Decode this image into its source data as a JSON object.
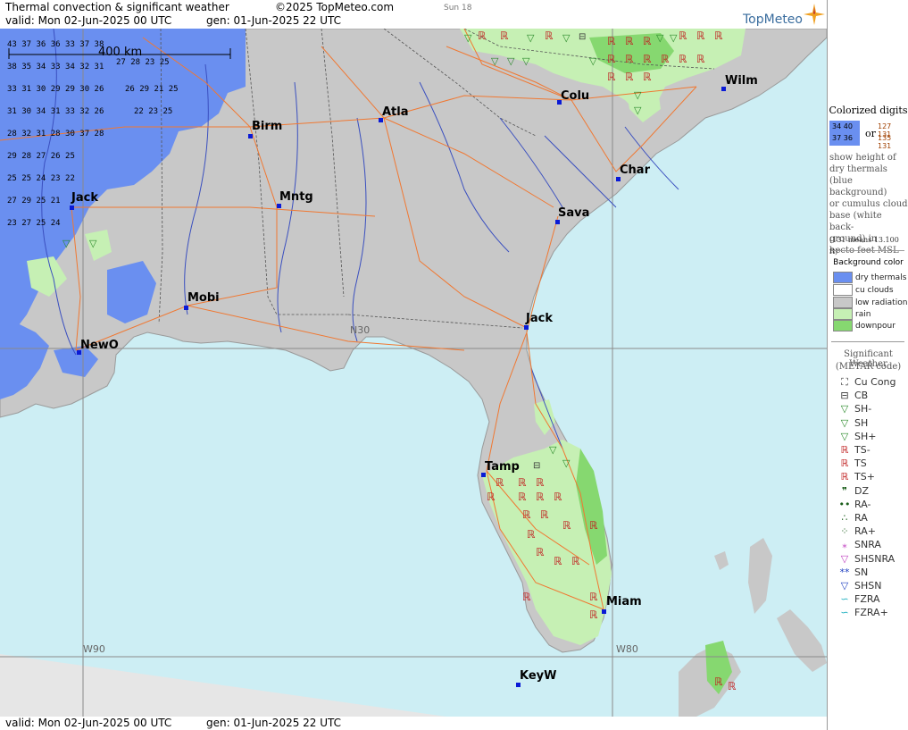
{
  "header": {
    "title": "Thermal convection & significant weather",
    "copyright": "©2025 TopMeteo.com",
    "time_label": "Sun 18",
    "valid": "valid:  Mon  02-Jun-2025  00 UTC",
    "generated": "gen: 01-Jun-2025 22 UTC",
    "logo": "TopMeteo"
  },
  "footer": {
    "valid": "valid:  Mon  02-Jun-2025  00 UTC",
    "generated": "gen: 01-Jun-2025 22 UTC"
  },
  "map": {
    "scale_label": "400 km",
    "grid_labels": [
      "N30",
      "W90",
      "W80"
    ],
    "cities": [
      "Wilm",
      "Colu",
      "Atla",
      "Birm",
      "Char",
      "Mntg",
      "Jack",
      "Sava",
      "Mobi",
      "Jack",
      "NewO",
      "Tamp",
      "Miam",
      "KeyW"
    ],
    "colors": {
      "sea": "#cdeef4",
      "land": "#c8c8c8",
      "dry_thermals": "#6a8ff0",
      "rain": "#c6f0b4",
      "downpour": "#86d870",
      "roads": "#f07832",
      "rivers": "#3a4fbf",
      "city": "#0a1ad6"
    }
  },
  "legend": {
    "digits_title": "Colorized digits",
    "digits_or": "or",
    "digits_desc": [
      "show height of",
      "dry thermals",
      "(blue background)",
      "or cumulus cloud",
      "base (white back-",
      "ground) in",
      "hecto feet MSL"
    ],
    "digits_note": "(131 means 13.100 ft)",
    "bg_title": "Background color",
    "bg_items": [
      {
        "label": "dry thermals",
        "color": "#6a8ff0"
      },
      {
        "label": "cu clouds",
        "color": "#ffffff"
      },
      {
        "label": "low radiation",
        "color": "#c8c8c8"
      },
      {
        "label": "rain",
        "color": "#c6f0b4"
      },
      {
        "label": "downpour",
        "color": "#86d870"
      }
    ],
    "wx_title": "Significant Weather",
    "wx_subtitle": "(METAR code)",
    "wx_items": [
      {
        "label": "Cu Cong",
        "glyph": "⛶",
        "color": "#333"
      },
      {
        "label": "CB",
        "glyph": "⊟",
        "color": "#333"
      },
      {
        "label": "SH-",
        "glyph": "▽",
        "color": "#2a8a2a"
      },
      {
        "label": "SH",
        "glyph": "▽",
        "color": "#2a8a2a"
      },
      {
        "label": "SH+",
        "glyph": "▽",
        "color": "#2a8a2a"
      },
      {
        "label": "TS-",
        "glyph": "ℝ",
        "color": "#c02020"
      },
      {
        "label": "TS",
        "glyph": "ℝ",
        "color": "#c02020"
      },
      {
        "label": "TS+",
        "glyph": "ℝ",
        "color": "#c02020"
      },
      {
        "label": "DZ",
        "glyph": "❞",
        "color": "#1b5e1b"
      },
      {
        "label": "RA-",
        "glyph": "••",
        "color": "#1b5e1b"
      },
      {
        "label": "RA",
        "glyph": "∴",
        "color": "#1b5e1b"
      },
      {
        "label": "RA+",
        "glyph": "⁘",
        "color": "#1b5e1b"
      },
      {
        "label": "SNRA",
        "glyph": "⁎",
        "color": "#c040c0"
      },
      {
        "label": "SHSNRA",
        "glyph": "▽",
        "color": "#c040c0"
      },
      {
        "label": "SN",
        "glyph": "**",
        "color": "#2040c0"
      },
      {
        "label": "SHSN",
        "glyph": "▽",
        "color": "#2040c0"
      },
      {
        "label": "FZRA",
        "glyph": "∽",
        "color": "#20b0c0"
      },
      {
        "label": "FZRA+",
        "glyph": "∽",
        "color": "#20b0c0"
      }
    ]
  }
}
